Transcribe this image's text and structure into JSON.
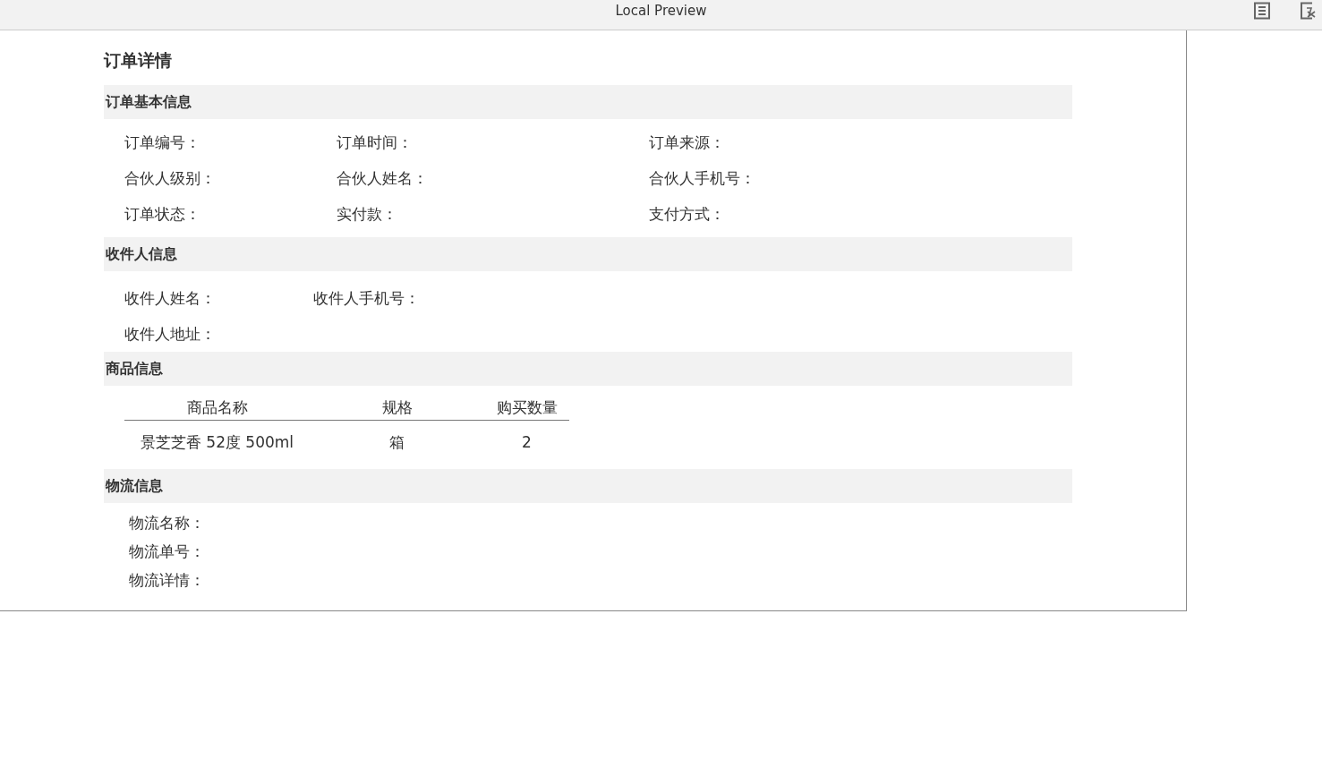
{
  "window": {
    "title": "Local Preview"
  },
  "page": {
    "title": "订单详情",
    "sections": [
      {
        "kind": "fields",
        "heading": "订单基本信息",
        "rows": [
          [
            "订单编号：",
            "订单时间：",
            "订单来源："
          ],
          [
            "合伙人级别：",
            "合伙人姓名：",
            "合伙人手机号："
          ],
          [
            "订单状态：",
            "实付款：",
            "支付方式："
          ]
        ]
      },
      {
        "kind": "fields",
        "heading": "收件人信息",
        "rows": [
          [
            "收件人姓名：",
            "收件人手机号："
          ],
          [
            "收件人地址："
          ]
        ]
      },
      {
        "kind": "table",
        "heading": "商品信息",
        "columns": [
          "商品名称",
          "规格",
          "购买数量"
        ],
        "rows": [
          [
            "景芝芝香 52度 500ml",
            "箱",
            "2"
          ]
        ]
      },
      {
        "kind": "list",
        "heading": "物流信息",
        "rows": [
          [
            "物流名称："
          ],
          [
            "物流单号："
          ],
          [
            "物流详情："
          ]
        ]
      }
    ]
  }
}
